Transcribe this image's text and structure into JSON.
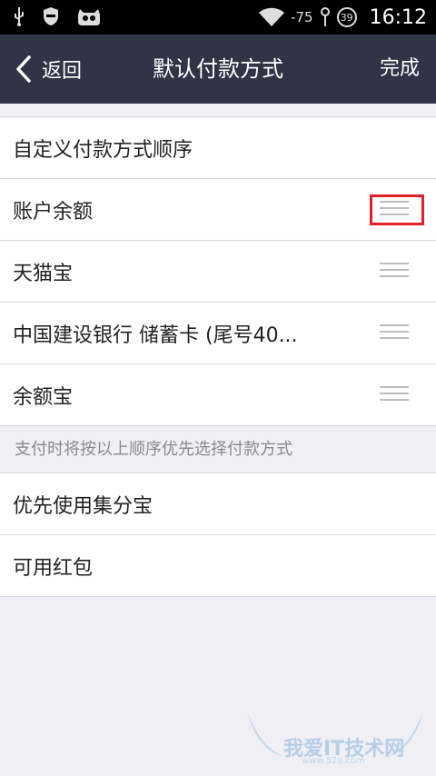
{
  "status_bar": {
    "signal": "-75",
    "badge": "39",
    "time": "16:12"
  },
  "nav": {
    "back_label": "返回",
    "title": "默认付款方式",
    "done_label": "完成"
  },
  "order_section": {
    "header": "自定义付款方式顺序",
    "items": [
      {
        "label": "账户余额",
        "highlighted": true
      },
      {
        "label": "天猫宝"
      },
      {
        "label": "中国建设银行 储蓄卡 (尾号40..."
      },
      {
        "label": "余额宝"
      }
    ]
  },
  "hint": "支付时将按以上顺序优先选择付款方式",
  "options_section": {
    "items": [
      {
        "label": "优先使用集分宝"
      },
      {
        "label": "可用红包"
      }
    ]
  },
  "watermark": {
    "text": "我爱IT技术网",
    "url": "www.52ij.com"
  },
  "colors": {
    "navbar_bg": "#2f3546",
    "highlight": "#e2202a",
    "page_bg": "#efeff4"
  }
}
